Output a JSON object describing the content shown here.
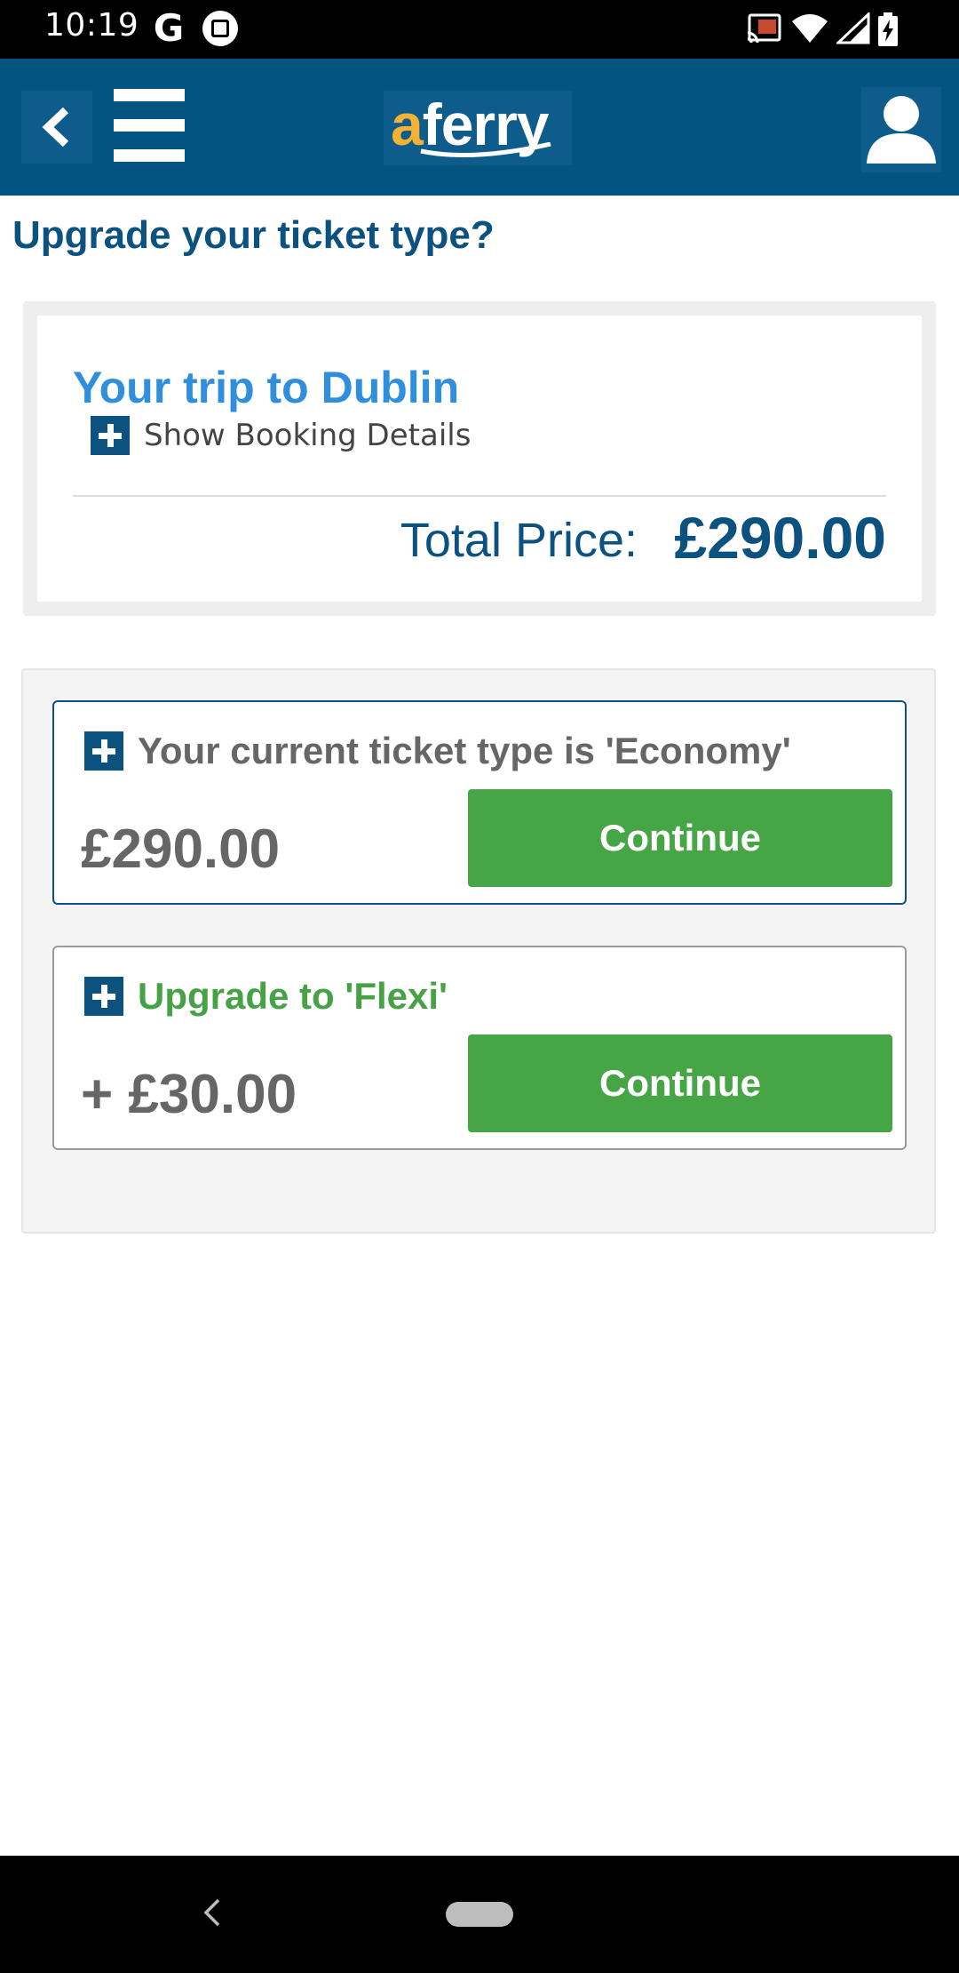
{
  "status_bar": {
    "time": "10:19",
    "google_icon": "G",
    "icons": [
      "google-icon",
      "photo-icon",
      "cast-icon",
      "wifi-icon",
      "signal-icon",
      "battery-charging-icon"
    ]
  },
  "header": {
    "logo_a": "a",
    "logo_rest": "ferry",
    "icons": [
      "back-icon",
      "menu-icon",
      "user-icon"
    ]
  },
  "page": {
    "title": "Upgrade your ticket type?"
  },
  "summary": {
    "trip_title": "Your trip to Dublin",
    "show_details": "Show Booking Details",
    "total_label": "Total Price:",
    "total_value": "£290.00"
  },
  "options": [
    {
      "heading": "Your current ticket type is 'Economy'",
      "price": "£290.00",
      "button": "Continue"
    },
    {
      "heading": "Upgrade to 'Flexi'",
      "price": "+ £30.00",
      "button": "Continue"
    }
  ],
  "colors": {
    "brand_blue": "#045482",
    "title_blue": "#0b5280",
    "trip_blue": "#2f8fdc",
    "button_green": "#46a545",
    "logo_orange": "#f3b234"
  }
}
